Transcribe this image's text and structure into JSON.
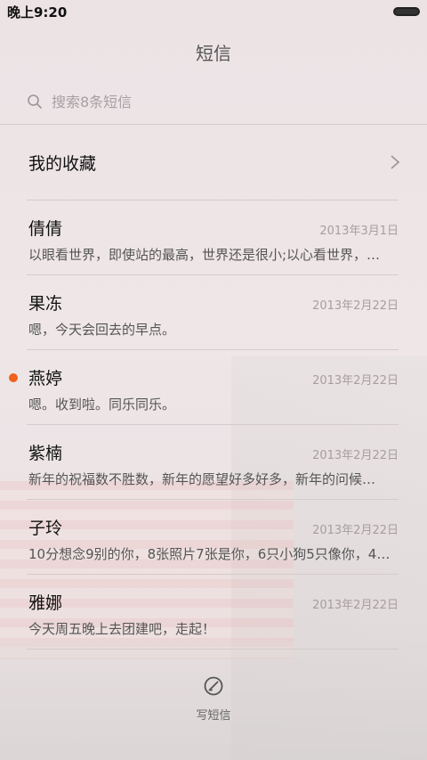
{
  "status_bar": {
    "time": "晚上9:20"
  },
  "header": {
    "title": "短信"
  },
  "search": {
    "placeholder": "搜索8条短信"
  },
  "favorites": {
    "label": "我的收藏"
  },
  "threads": [
    {
      "name": "倩倩",
      "date": "2013年3月1日",
      "preview": "以眼看世界，即使站的最高，世界还是很小;以心看世界，…",
      "unread": false
    },
    {
      "name": "果冻",
      "date": "2013年2月22日",
      "preview": "嗯，今天会回去的早点。",
      "unread": false
    },
    {
      "name": "燕婷",
      "date": "2013年2月22日",
      "preview": "嗯。收到啦。同乐同乐。",
      "unread": true
    },
    {
      "name": "紫楠",
      "date": "2013年2月22日",
      "preview": "新年的祝福数不胜数，新年的愿望好多好多，新年的问候…",
      "unread": false
    },
    {
      "name": "子玲",
      "date": "2013年2月22日",
      "preview": "10分想念9别的你，8张照片7张是你，6只小狗5只像你，4…",
      "unread": false
    },
    {
      "name": "雅娜",
      "date": "2013年2月22日",
      "preview": "今天周五晚上去团建吧，走起！",
      "unread": false
    }
  ],
  "compose": {
    "label": "写短信",
    "icon": "compose-icon"
  },
  "colors": {
    "unread_dot": "#f0601e"
  }
}
